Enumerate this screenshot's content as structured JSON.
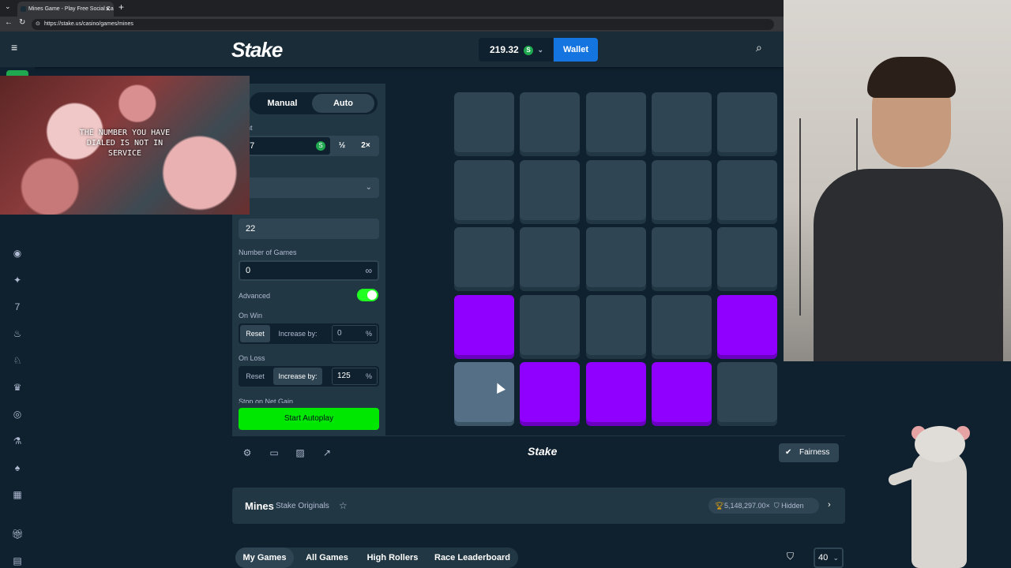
{
  "browser": {
    "tab_title": "Mines Game - Play Free Social Ca",
    "url": "https://stake.us/casino/games/mines"
  },
  "header": {
    "logo": "Stake",
    "balance": "219.32",
    "coin_symbol": "S",
    "wallet_label": "Wallet"
  },
  "webcam_text": "THE NUMBER YOU HAVE DIALED IS NOT IN SERVICE",
  "panel": {
    "tab_manual": "Manual",
    "tab_auto": "Auto",
    "amount_label_partial": "ount",
    "amount_value": "07",
    "half_label": "½",
    "double_label": "2×",
    "mines_label_partial": "es",
    "gems_label_partial": "ns",
    "gems_value": "22",
    "num_games_label": "Number of Games",
    "num_games_value": "0",
    "infinity_symbol": "∞",
    "advanced_label": "Advanced",
    "on_win_label": "On Win",
    "on_win_reset": "Reset",
    "on_win_increase": "Increase by:",
    "on_win_value": "0",
    "on_loss_label": "On Loss",
    "on_loss_reset": "Reset",
    "on_loss_increase": "Increase by:",
    "on_loss_value": "125",
    "percent": "%",
    "stop_net_gain_partial": "Stop on Net Gain",
    "start_autoplay": "Start Autoplay"
  },
  "board": {
    "gem_tiles": [
      15,
      19,
      21,
      22,
      23
    ],
    "hover_tile": 20
  },
  "footer": {
    "logo": "Stake",
    "fairness": "Fairness"
  },
  "info": {
    "game_title": "Mines",
    "game_sub": "Stake Originals",
    "max_win": "5,148,297.00×",
    "hidden": "Hidden"
  },
  "tabs": [
    "My Games",
    "All Games",
    "High Rollers",
    "Race Leaderboard"
  ],
  "row_count": "40",
  "colors": {
    "gem": "#9000ff",
    "accent_green": "#00e701",
    "wallet_blue": "#1475e1"
  }
}
